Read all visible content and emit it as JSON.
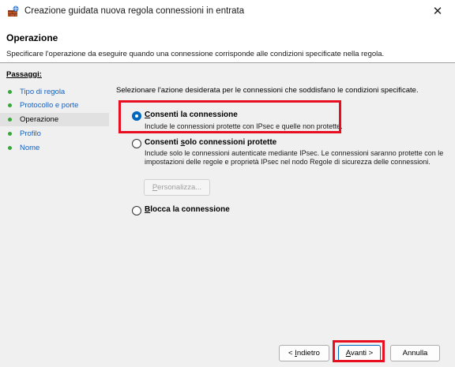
{
  "window": {
    "title": "Creazione guidata nuova regola connessioni in entrata",
    "close_glyph": "✕",
    "icon": "firewall-rule-icon"
  },
  "header": {
    "title": "Operazione",
    "description": "Specificare l'operazione da eseguire quando una connessione corrisponde alle condizioni specificate nella regola."
  },
  "sidebar": {
    "title": "Passaggi:",
    "items": [
      {
        "label": "Tipo di regola"
      },
      {
        "label": "Protocollo e porte"
      },
      {
        "label": "Operazione"
      },
      {
        "label": "Profilo"
      },
      {
        "label": "Nome"
      }
    ],
    "current": "Operazione"
  },
  "main": {
    "intro": "Selezionare l'azione desiderata per le connessioni che soddisfano le condizioni specificate.",
    "options": [
      {
        "label_prefix": "",
        "label_accel": "C",
        "label_rest": "onsenti la connessione",
        "description": "Include le connessioni protette con IPsec e quelle non protette.",
        "selected": true
      },
      {
        "label_prefix": "Consenti ",
        "label_accel": "s",
        "label_rest": "olo connessioni protette",
        "description": "Include solo le connessioni autenticate mediante IPsec. Le connessioni saranno protette con le impostazioni delle regole e proprietà IPsec nel nodo Regole di sicurezza delle connessioni.",
        "selected": false
      },
      {
        "label_prefix": "",
        "label_accel": "B",
        "label_rest": "locca la connessione",
        "description": "",
        "selected": false
      }
    ],
    "customize_button": {
      "accel": "P",
      "rest": "ersonalizza..."
    }
  },
  "footer": {
    "back": {
      "prefix": "< ",
      "accel": "I",
      "rest": "ndietro"
    },
    "next": {
      "accel": "A",
      "rest": "vanti >"
    },
    "cancel": {
      "label": "Annulla"
    }
  },
  "colors": {
    "highlight": "#e81020",
    "link": "#1560bd",
    "step_dot": "#3aa63a",
    "radio_selected": "#0067c0"
  }
}
